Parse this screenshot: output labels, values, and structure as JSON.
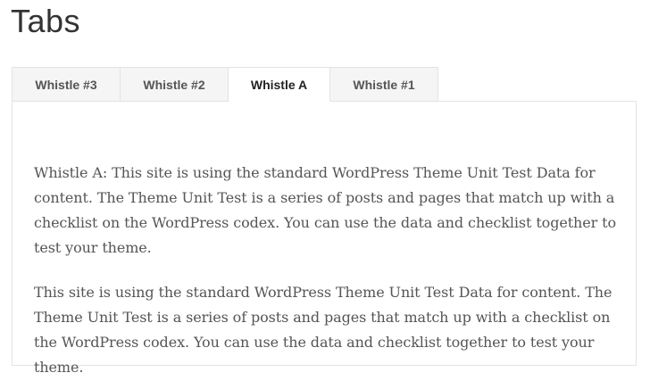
{
  "page": {
    "title": "Tabs"
  },
  "tabs": {
    "items": [
      {
        "label": "Whistle #3",
        "active": false
      },
      {
        "label": "Whistle #2",
        "active": false
      },
      {
        "label": "Whistle A",
        "active": true
      },
      {
        "label": "Whistle #1",
        "active": false
      }
    ],
    "active_panel": {
      "paragraphs": [
        "Whistle A: This site is using the standard WordPress Theme Unit Test Data for content. The Theme Unit Test is a series of posts and pages that match up with a checklist on the WordPress codex. You can use the data and checklist together to test your theme.",
        "This site is using the standard WordPress Theme Unit Test Data for content. The Theme Unit Test is a series of posts and pages that match up with a checklist on the WordPress codex. You can use the data and checklist together to test your theme."
      ]
    }
  },
  "colors": {
    "tab_inactive_bg": "#f5f5f5",
    "tab_active_bg": "#ffffff",
    "border": "#e3e3e3",
    "title_text": "#333333",
    "body_text": "#555555"
  }
}
